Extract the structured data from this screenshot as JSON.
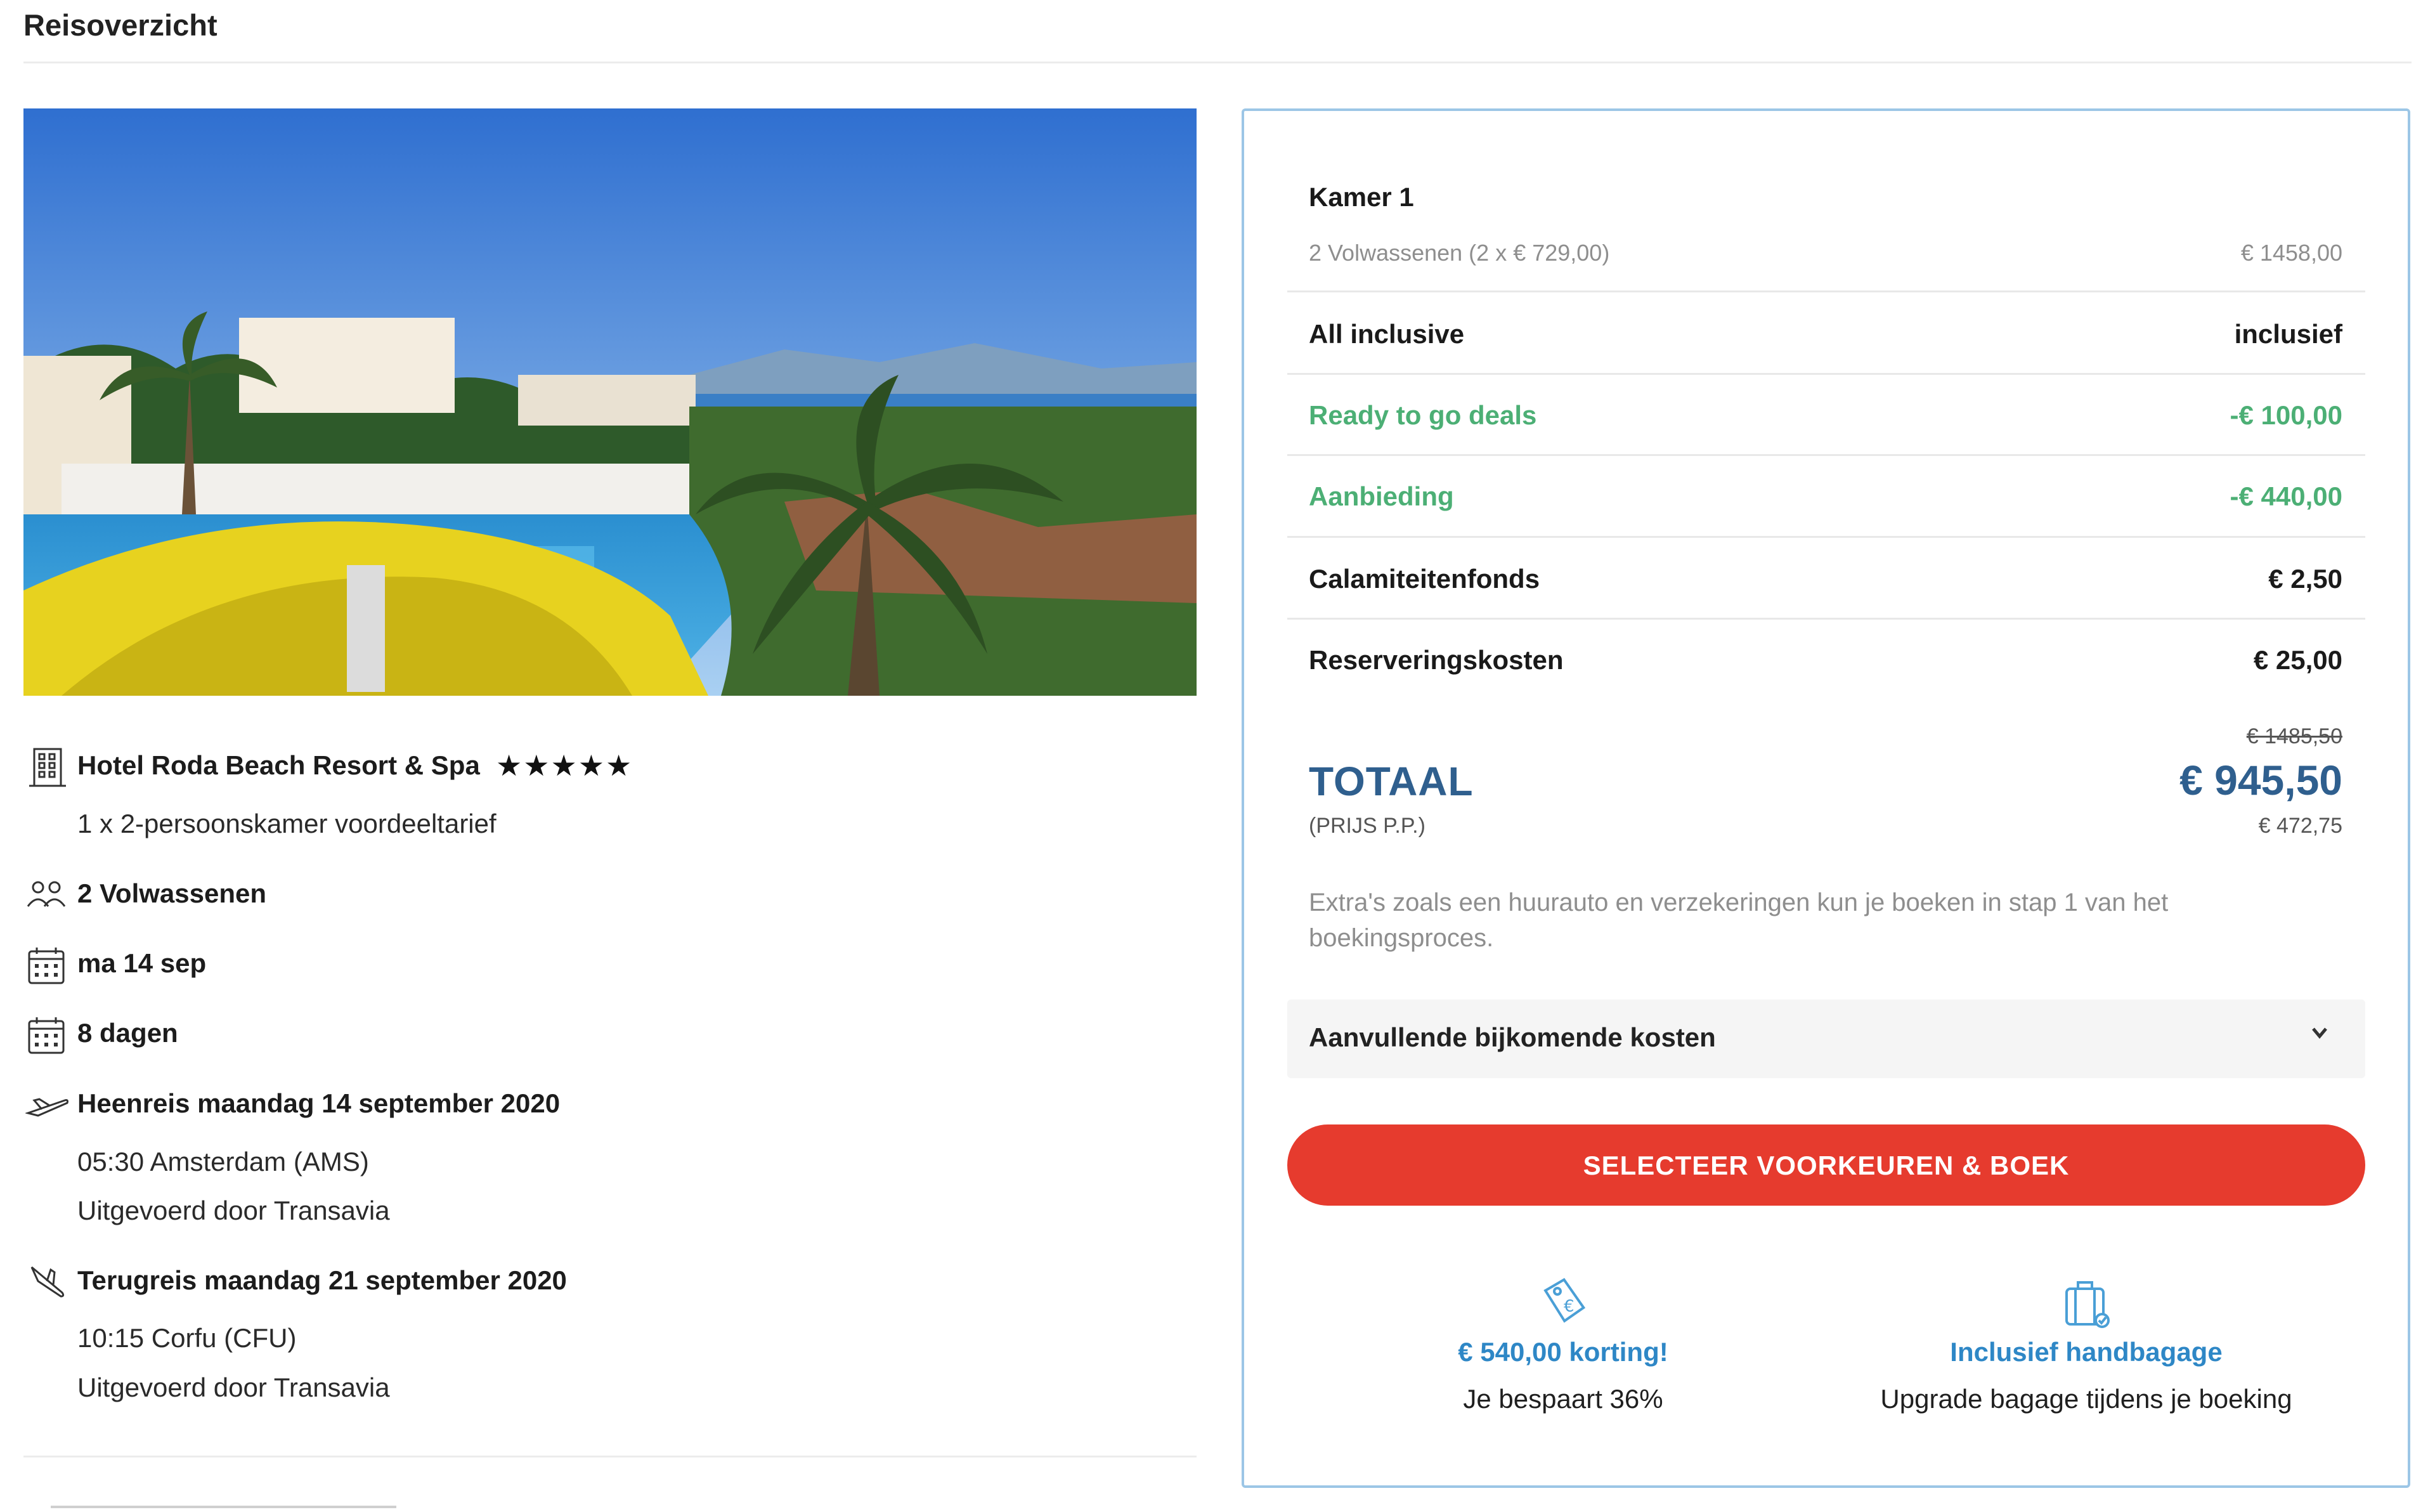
{
  "header": {
    "title": "Reisoverzicht"
  },
  "hotel": {
    "name": "Hotel Roda Beach Resort & Spa",
    "stars": "★★★★★",
    "room": "1 x 2-persoonskamer voordeeltarief"
  },
  "details": {
    "travelers": "2 Volwassenen",
    "date": "ma 14 sep",
    "duration": "8 dagen"
  },
  "outbound": {
    "title": "Heenreis maandag 14 september 2020",
    "departure": "05:30 Amsterdam (AMS)",
    "operator": "Uitgevoerd door Transavia"
  },
  "return": {
    "title": "Terugreis maandag 21 september 2020",
    "departure": "10:15 Corfu (CFU)",
    "operator": "Uitgevoerd door Transavia"
  },
  "price": {
    "room_title": "Kamer 1",
    "room_detail": "2 Volwassenen (2 x € 729,00)",
    "room_amount": "€ 1458,00",
    "rows": [
      {
        "label": "All inclusive",
        "value": "inclusief"
      },
      {
        "label": "Ready to go deals",
        "value": "-€ 100,00"
      },
      {
        "label": "Aanbieding",
        "value": "-€ 440,00"
      },
      {
        "label": "Calamiteitenfonds",
        "value": "€ 2,50"
      },
      {
        "label": "Reserveringskosten",
        "value": "€ 25,00"
      }
    ],
    "total_label": "TOTAAL",
    "total_sub": "(PRIJS P.P.)",
    "old_total": "€ 1485,50",
    "total": "€ 945,50",
    "per_person": "€ 472,75",
    "extras_note": "Extra's zoals een huurauto en verzekeringen kun je boeken in stap 1 van het boekingsproces.",
    "extra_costs_label": "Aanvullende bijkomende kosten",
    "cta": "SELECTEER VOORKEUREN & BOEK",
    "usp": [
      {
        "title": "€ 540,00 korting!",
        "sub": "Je bespaart 36%",
        "icon": "discount-tag-icon"
      },
      {
        "title": "Inclusief handbagage",
        "sub": "Upgrade bagage tijdens je boeking",
        "icon": "suitcase-icon"
      }
    ]
  },
  "colors": {
    "accent_blue": "#2f5f8e",
    "link_blue": "#2e87c6",
    "discount_green": "#4caf75",
    "cta_red": "#e63b2e",
    "card_border": "#9cc6e6"
  }
}
